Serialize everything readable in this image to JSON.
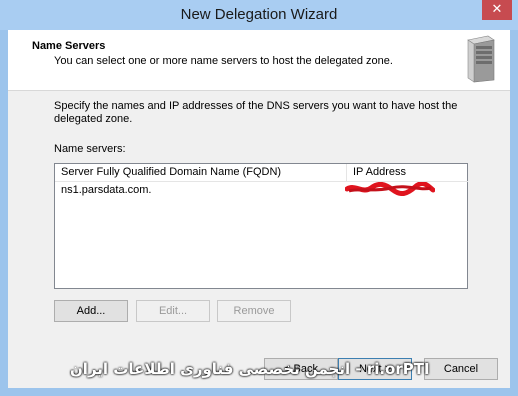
{
  "window": {
    "title": "New Delegation Wizard",
    "close_glyph": "✕"
  },
  "header": {
    "title": "Name Servers",
    "subtitle": "You can select one or more name servers to host the delegated zone.",
    "icon": "server-icon"
  },
  "body": {
    "description": "Specify the names and IP addresses of the DNS servers you want to have host the delegated zone.",
    "list_label": "Name servers:",
    "columns": [
      "Server Fully Qualified Domain Name (FQDN)",
      "IP Address"
    ],
    "rows": [
      {
        "fqdn": "ns1.parsdata.com.",
        "ip": ""
      }
    ]
  },
  "buttons": {
    "add": "Add...",
    "edit": "Edit...",
    "remove": "Remove",
    "back": "< Back",
    "next": "Next >",
    "cancel": "Cancel"
  },
  "watermark": {
    "text": "ITPro.ir - انجمن تخصصی فناوری اطلاعات ایران"
  }
}
